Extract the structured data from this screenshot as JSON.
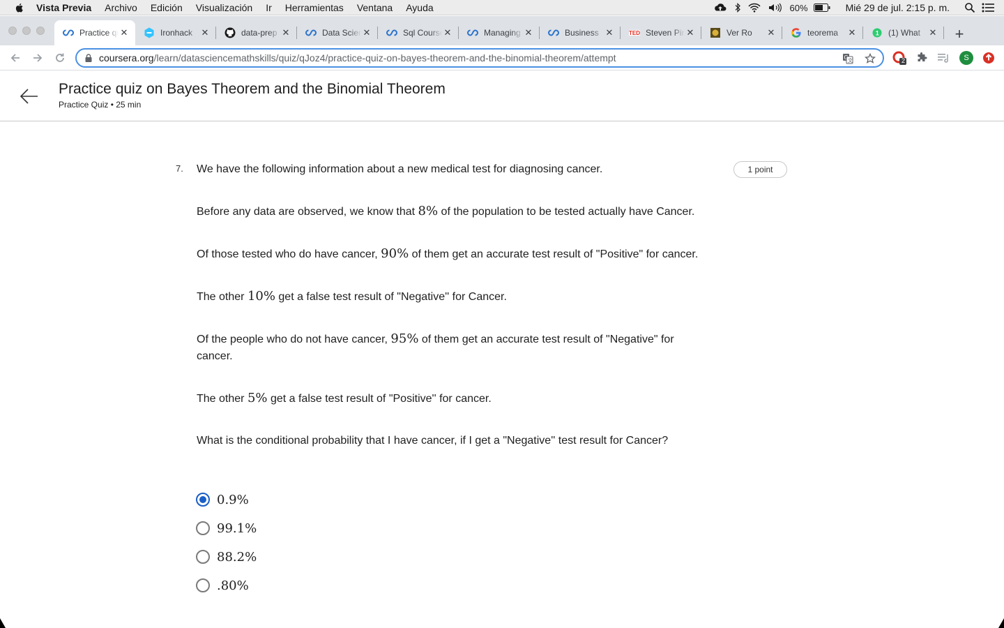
{
  "menubar": {
    "app_name": "Vista Previa",
    "items": [
      "Archivo",
      "Edición",
      "Visualización",
      "Ir",
      "Herramientas",
      "Ventana",
      "Ayuda"
    ],
    "battery": "60%",
    "clock": "Mié 29 de jul.  2:15 p. m."
  },
  "tabs": [
    {
      "title": "Practice quiz on Bayes",
      "favicon": "coursera-icon",
      "active": true
    },
    {
      "title": "Ironhack",
      "favicon": "ironhack-icon"
    },
    {
      "title": "data-prep",
      "favicon": "github-icon"
    },
    {
      "title": "Data Science",
      "favicon": "coursera-icon"
    },
    {
      "title": "Sql Course",
      "favicon": "coursera-icon"
    },
    {
      "title": "Managing",
      "favicon": "coursera-icon"
    },
    {
      "title": "Business",
      "favicon": "coursera-icon"
    },
    {
      "title": "Steven Pinker",
      "favicon": "ted-icon"
    },
    {
      "title": "Ver Ro",
      "favicon": "badge-icon"
    },
    {
      "title": "teorema",
      "favicon": "google-icon"
    },
    {
      "title": "(1) What",
      "favicon": "quora-icon"
    }
  ],
  "omnibox": {
    "host": "coursera.org",
    "path": "/learn/datasciencemathskills/quiz/qJoz4/practice-quiz-on-bayes-theorem-and-the-binomial-theorem/attempt"
  },
  "extensions": {
    "badge_count": "2",
    "profile_initial": "S"
  },
  "header": {
    "title": "Practice quiz on Bayes Theorem and the Binomial Theorem",
    "subtitle": "Practice Quiz • 25 min"
  },
  "question": {
    "number": "7.",
    "points": "1 point",
    "paragraphs": [
      {
        "parts": [
          "We have the following information about a new medical test for diagnosing cancer."
        ]
      },
      {
        "parts": [
          "Before any data are observed, we know that ",
          "8%",
          " of the population to be tested actually have Cancer."
        ]
      },
      {
        "parts": [
          "Of those tested who do have cancer, ",
          "90%",
          " of them get an accurate test result of \"Positive\" for cancer."
        ]
      },
      {
        "parts": [
          "The other ",
          "10%",
          " get a false test result of \"Negative'' for Cancer."
        ]
      },
      {
        "parts": [
          "Of the people who do not have cancer, ",
          "95%",
          " of them get an accurate test result of \"Negative\" for cancer."
        ]
      },
      {
        "parts": [
          "The other ",
          "5%",
          " get a false test result of \"Positive'' for cancer."
        ]
      },
      {
        "parts": [
          "What is the conditional probability that I have cancer, if I get a \"Negative'' test result for Cancer?"
        ]
      }
    ],
    "options": [
      {
        "label": "0.9%",
        "selected": true
      },
      {
        "label": "99.1%",
        "selected": false
      },
      {
        "label": "88.2%",
        "selected": false
      },
      {
        "label": ".80%",
        "selected": false
      }
    ]
  },
  "colors": {
    "accent": "#1a5fc7",
    "omnibox_focus": "#4a90e2",
    "tab_strip": "#dee1e6"
  }
}
